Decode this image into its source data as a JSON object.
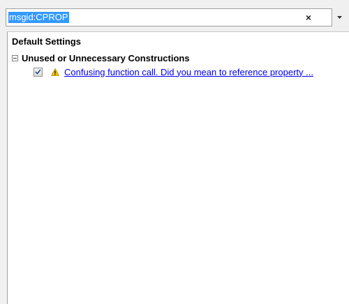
{
  "search": {
    "value": "msgid:CPROP",
    "clear_label": "×",
    "dropdown_icon": "chevron-down-icon"
  },
  "panel": {
    "section_title": "Default Settings",
    "groups": [
      {
        "label": "Unused or Unnecessary Constructions",
        "expanded": true,
        "items": [
          {
            "checked": true,
            "icon": "warning-icon",
            "label": "Confusing function call. Did you mean to reference property ..."
          }
        ]
      }
    ]
  },
  "colors": {
    "selection": "#3399ff",
    "link": "#0000ee",
    "warning": "#f2c200"
  }
}
